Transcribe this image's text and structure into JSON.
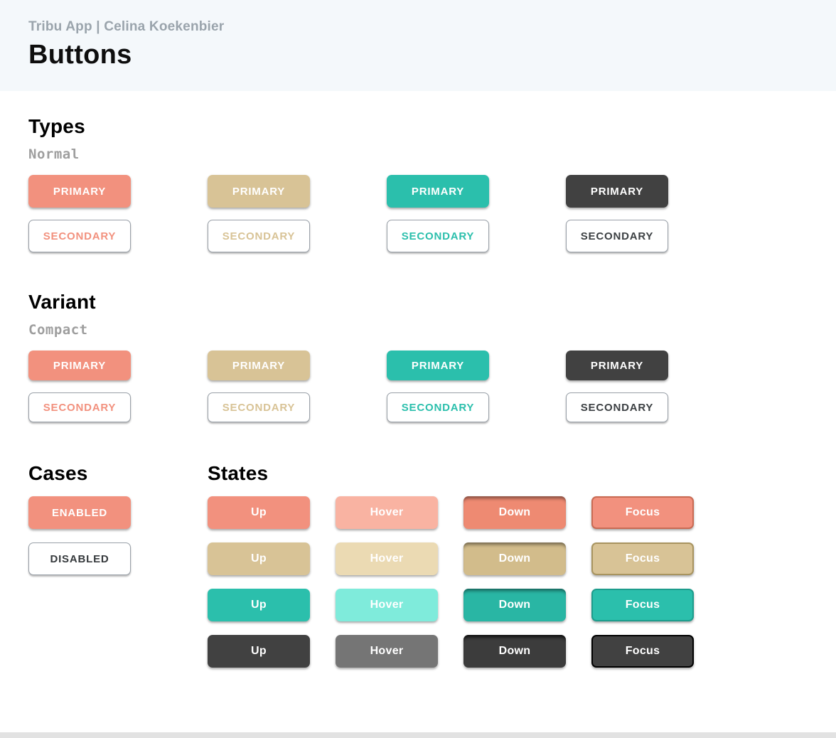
{
  "header": {
    "subtitle": "Tribu App | Celina Koekenbier",
    "title": "Buttons"
  },
  "sections": {
    "types": {
      "heading": "Types",
      "mode_label": "Normal",
      "primary_buttons": [
        {
          "label": "PRIMARY",
          "theme": "salmon"
        },
        {
          "label": "PRIMARY",
          "theme": "tan"
        },
        {
          "label": "PRIMARY",
          "theme": "teal"
        },
        {
          "label": "PRIMARY",
          "theme": "dark"
        }
      ],
      "secondary_buttons": [
        {
          "label": "SECONDARY",
          "theme": "salmon"
        },
        {
          "label": "SECONDARY",
          "theme": "tan"
        },
        {
          "label": "SECONDARY",
          "theme": "teal"
        },
        {
          "label": "SECONDARY",
          "theme": "dark"
        }
      ]
    },
    "variant": {
      "heading": "Variant",
      "mode_label": "Compact",
      "primary_buttons": [
        {
          "label": "PRIMARY",
          "theme": "salmon"
        },
        {
          "label": "PRIMARY",
          "theme": "tan"
        },
        {
          "label": "PRIMARY",
          "theme": "teal"
        },
        {
          "label": "PRIMARY",
          "theme": "dark"
        }
      ],
      "secondary_buttons": [
        {
          "label": "SECONDARY",
          "theme": "salmon"
        },
        {
          "label": "SECONDARY",
          "theme": "tan"
        },
        {
          "label": "SECONDARY",
          "theme": "teal"
        },
        {
          "label": "SECONDARY",
          "theme": "dark"
        }
      ]
    },
    "cases": {
      "heading": "Cases",
      "buttons": [
        {
          "label": "ENABLED",
          "kind": "primary",
          "theme": "salmon"
        },
        {
          "label": "DISABLED",
          "kind": "disabled"
        }
      ]
    },
    "states": {
      "heading": "States",
      "rows": [
        {
          "theme": "salmon",
          "cells": [
            {
              "label": "Up"
            },
            {
              "label": "Hover"
            },
            {
              "label": "Down"
            },
            {
              "label": "Focus"
            }
          ]
        },
        {
          "theme": "tan",
          "cells": [
            {
              "label": "Up"
            },
            {
              "label": "Hover"
            },
            {
              "label": "Down"
            },
            {
              "label": "Focus"
            }
          ]
        },
        {
          "theme": "teal",
          "cells": [
            {
              "label": "Up"
            },
            {
              "label": "Hover"
            },
            {
              "label": "Down"
            },
            {
              "label": "Focus"
            }
          ]
        },
        {
          "theme": "dark",
          "cells": [
            {
              "label": "Up"
            },
            {
              "label": "Hover"
            },
            {
              "label": "Down"
            },
            {
              "label": "Focus"
            }
          ]
        }
      ]
    }
  },
  "colors": {
    "salmon": {
      "base": "#F2917E",
      "hover": "#F9B3A2",
      "down": "#EE8A72",
      "focus_border": "#C96A53"
    },
    "tan": {
      "base": "#D8C396",
      "hover": "#EBDAB3",
      "down": "#D2BC8B",
      "focus_border": "#A8945F"
    },
    "teal": {
      "base": "#2BBFAC",
      "hover": "#7FEBDB",
      "down": "#29B6A4",
      "focus_border": "#1D9C8C"
    },
    "dark": {
      "base": "#414141",
      "hover": "#757575",
      "down": "#3C3C3C",
      "focus_border": "#000000"
    },
    "ui": {
      "header_bg": "#F4F8FB",
      "subtitle_color": "#9AA4AC",
      "mode_label_color": "#9E9E9E",
      "secondary_border": "#99A0A8",
      "scroll_track": "#E2E2E2"
    }
  }
}
